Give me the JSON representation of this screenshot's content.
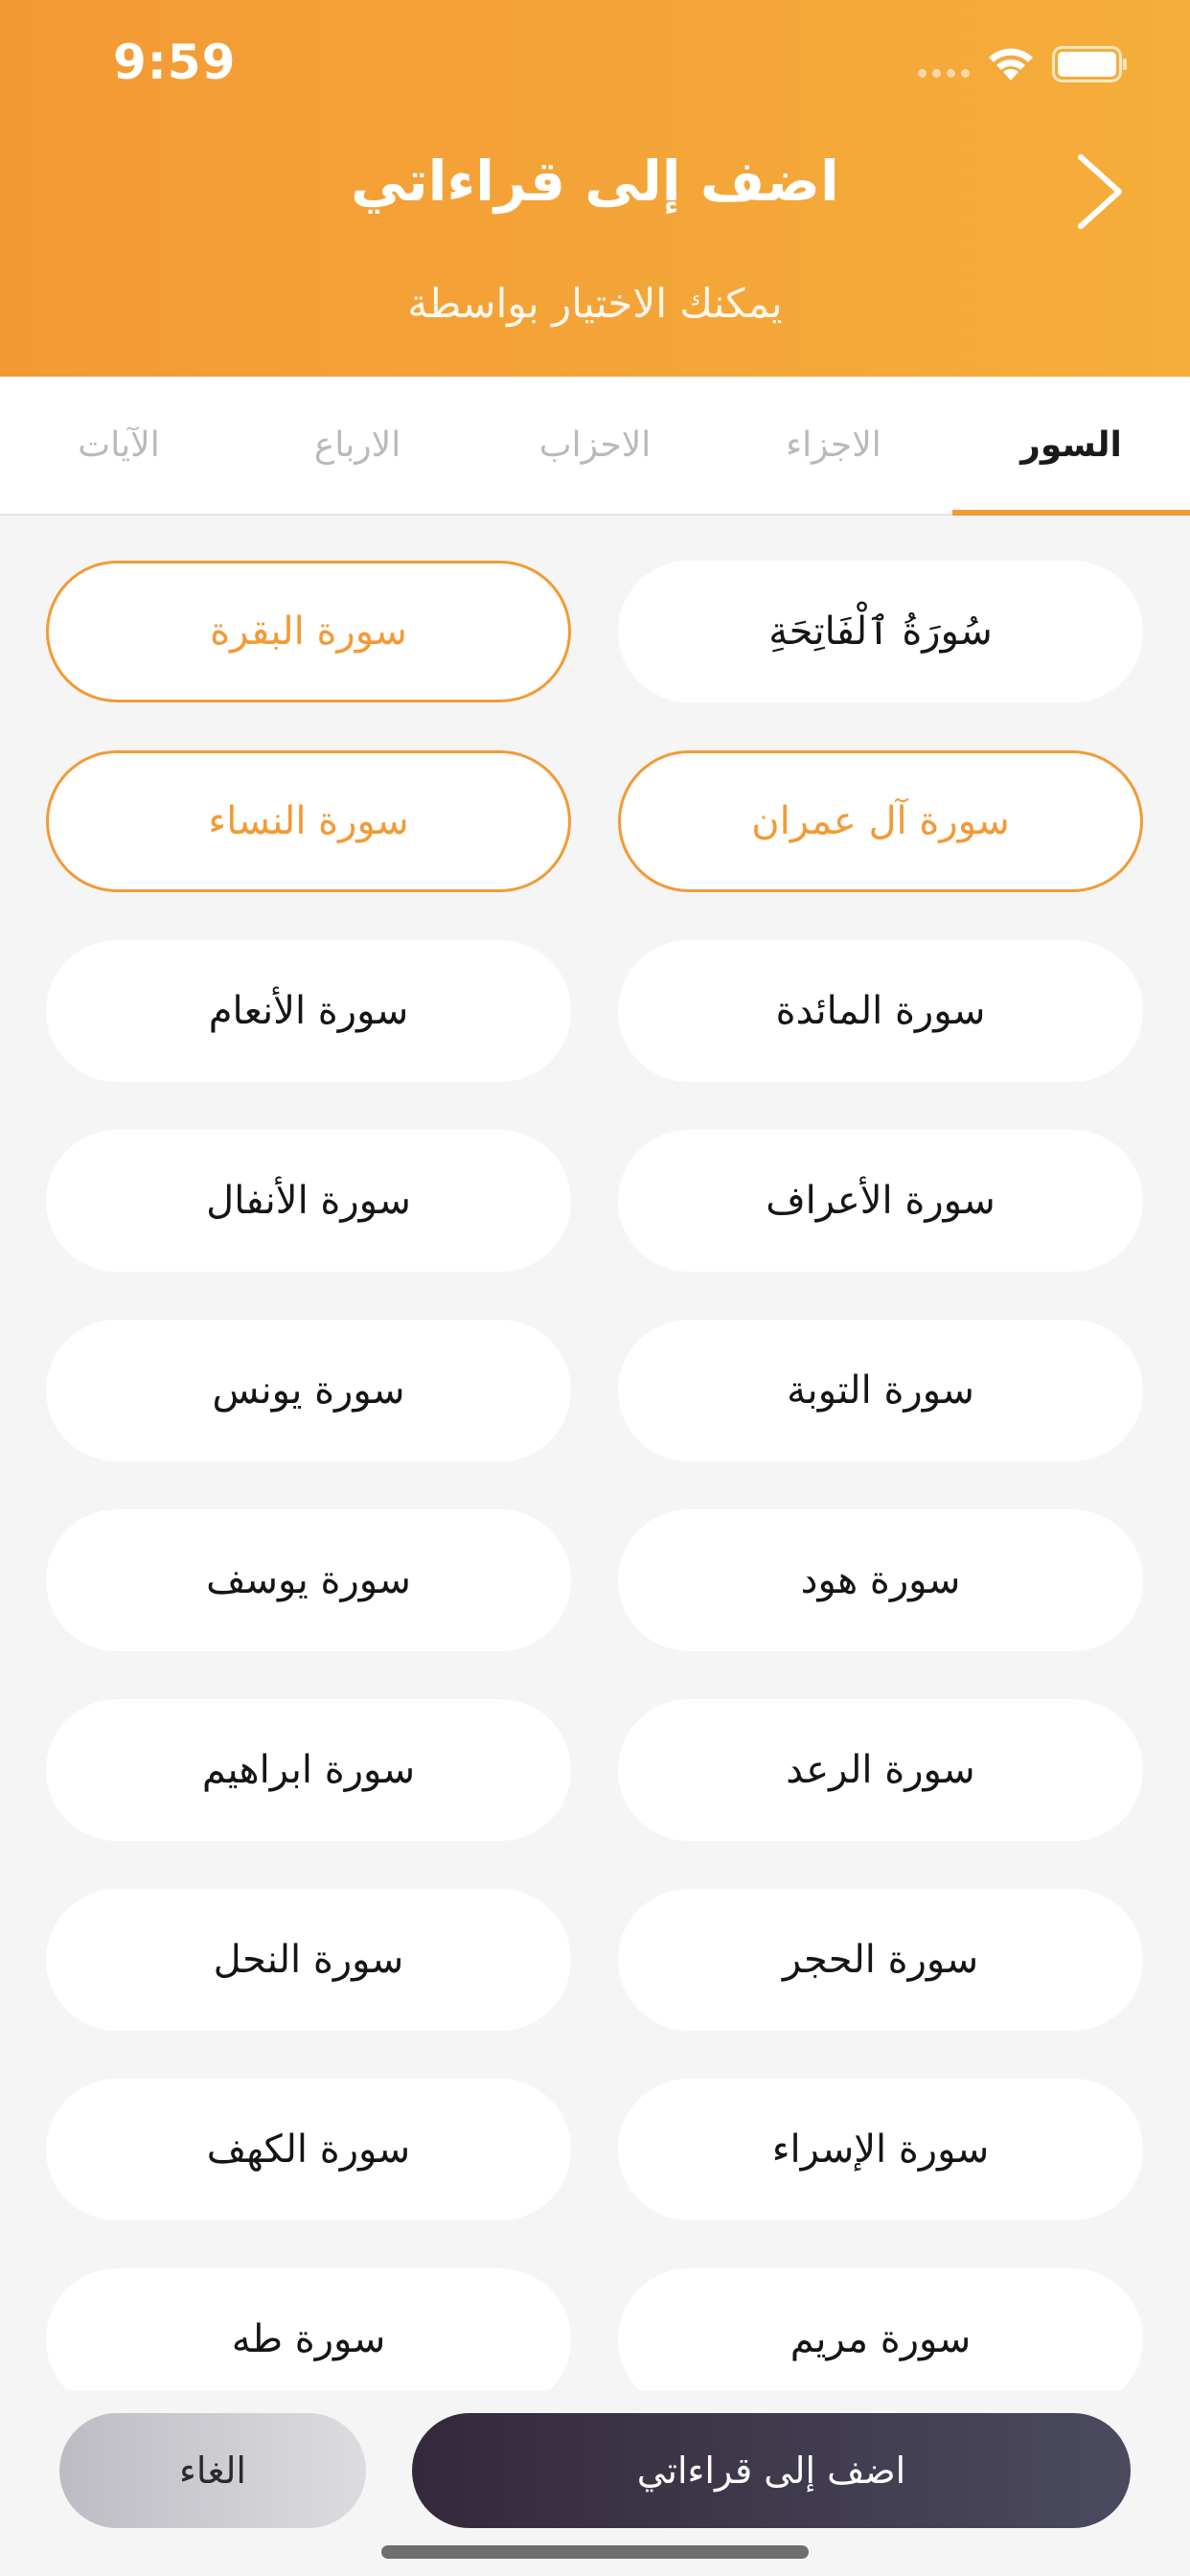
{
  "status_bar": {
    "time": "9:59"
  },
  "header": {
    "title": "اضف إلى قراءاتي",
    "subtitle": "يمكنك الاختيار بواسطة"
  },
  "tabs": [
    {
      "label": "السور",
      "active": true
    },
    {
      "label": "الاجزاء",
      "active": false
    },
    {
      "label": "الاحزاب",
      "active": false
    },
    {
      "label": "الارباع",
      "active": false
    },
    {
      "label": "الآيات",
      "active": false
    }
  ],
  "surahs": [
    {
      "label": "سُورَةُ ٱلْفَاتِحَةِ",
      "selected": false
    },
    {
      "label": "سورة البقرة",
      "selected": true
    },
    {
      "label": "سورة آل عمران",
      "selected": true
    },
    {
      "label": "سورة النساء",
      "selected": true
    },
    {
      "label": "سورة المائدة",
      "selected": false
    },
    {
      "label": "سورة الأنعام",
      "selected": false
    },
    {
      "label": "سورة الأعراف",
      "selected": false
    },
    {
      "label": "سورة الأنفال",
      "selected": false
    },
    {
      "label": "سورة التوبة",
      "selected": false
    },
    {
      "label": "سورة يونس",
      "selected": false
    },
    {
      "label": "سورة هود",
      "selected": false
    },
    {
      "label": "سورة يوسف",
      "selected": false
    },
    {
      "label": "سورة الرعد",
      "selected": false
    },
    {
      "label": "سورة ابراهيم",
      "selected": false
    },
    {
      "label": "سورة الحجر",
      "selected": false
    },
    {
      "label": "سورة النحل",
      "selected": false
    },
    {
      "label": "سورة الإسراء",
      "selected": false
    },
    {
      "label": "سورة الكهف",
      "selected": false
    },
    {
      "label": "سورة مريم",
      "selected": false
    },
    {
      "label": "سورة طه",
      "selected": false
    }
  ],
  "footer": {
    "add_label": "اضف إلى قراءاتي",
    "cancel_label": "الغاء"
  },
  "colors": {
    "accent": "#f39a35",
    "primary_button": "#3c3346",
    "background": "#f5f5f5"
  }
}
